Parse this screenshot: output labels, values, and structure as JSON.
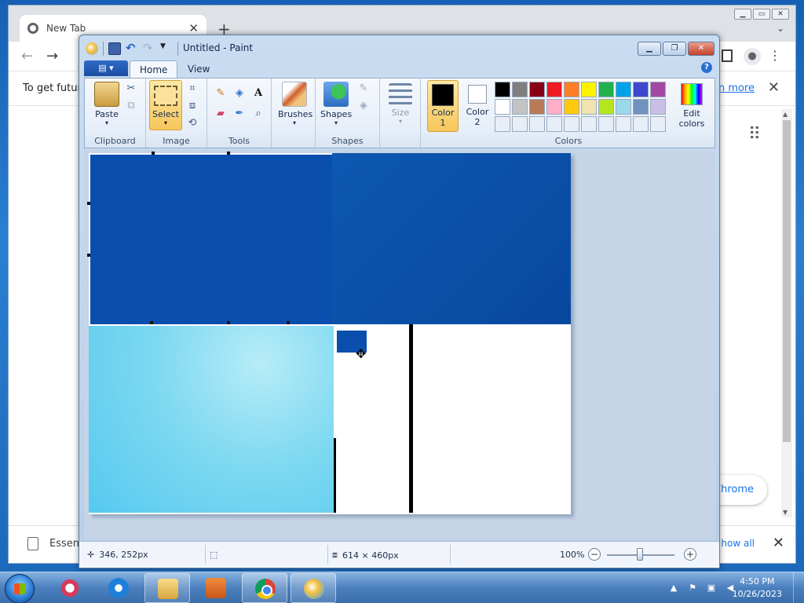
{
  "chrome": {
    "tab_title": "New Tab",
    "tab_close": "✕",
    "new_tab": "+",
    "collapse": "⌄",
    "infobar_text": "To get future",
    "infobar_link": "rn more",
    "infobar_close": "✕",
    "pill_text": "Chrome",
    "download_name": "Essent",
    "download_show_all": "how all",
    "download_close": "✕"
  },
  "paint": {
    "title": "Untitled - Paint",
    "tabs": {
      "home": "Home",
      "view": "View"
    },
    "groups": {
      "clipboard": "Clipboard",
      "image": "Image",
      "tools": "Tools",
      "shapes": "Shapes",
      "colors": "Colors"
    },
    "buttons": {
      "paste": "Paste",
      "select": "Select",
      "brushes": "Brushes",
      "shapes": "Shapes",
      "size": "Size",
      "color1_line1": "Color",
      "color1_line2": "1",
      "color2_line1": "Color",
      "color2_line2": "2",
      "edit_colors_line1": "Edit",
      "edit_colors_line2": "colors"
    },
    "palette_row1": [
      "#000000",
      "#7f7f7f",
      "#880015",
      "#ed1c24",
      "#ff7f27",
      "#fff200",
      "#22b14c",
      "#00a2e8",
      "#3f48cc",
      "#a349a4"
    ],
    "palette_row2": [
      "#ffffff",
      "#c3c3c3",
      "#b97a57",
      "#ffaec9",
      "#ffc90e",
      "#efe4b0",
      "#b5e61d",
      "#99d9ea",
      "#7092be",
      "#c8bfe7"
    ],
    "status": {
      "cursor_pos": "346, 252px",
      "canvas_size": "614 × 460px",
      "zoom": "100%"
    }
  },
  "taskbar": {
    "time": "4:50 PM",
    "date": "10/26/2023"
  }
}
